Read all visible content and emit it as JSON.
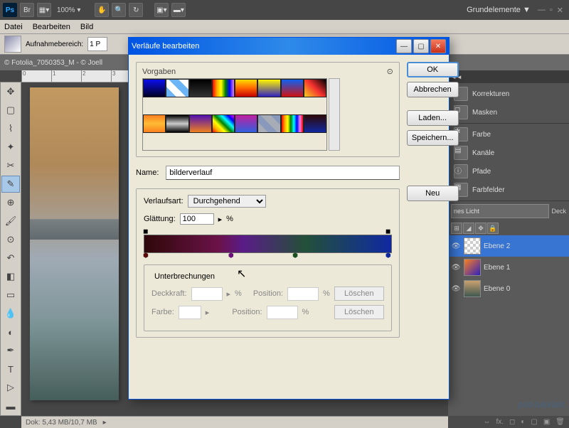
{
  "app": {
    "workspace": "Grundelemente"
  },
  "menu": [
    "Datei",
    "Bearbeiten",
    "Bild"
  ],
  "options": {
    "sample_label": "Aufnahmebereich:",
    "sample_value": "1 P"
  },
  "doc_tab": "© Fotolia_7050353_M - © Joell",
  "status": {
    "dock": "Dok: 5,43 MB/10,7 MB"
  },
  "panels": {
    "korrekturen": "Korrekturen",
    "masken": "Masken",
    "farbe": "Farbe",
    "kanale": "Kanäle",
    "pfade": "Pfade",
    "farbfelder": "Farbfelder"
  },
  "layers": {
    "blend": "nes Licht",
    "opacity_label": "Deck",
    "items": [
      {
        "name": "Ebene 2",
        "selected": true,
        "thumb": "checker"
      },
      {
        "name": "Ebene 1",
        "thumb": "gradient"
      },
      {
        "name": "Ebene 0",
        "thumb": "photo"
      }
    ]
  },
  "dialog": {
    "title": "Verläufe bearbeiten",
    "vorgaben_label": "Vorgaben",
    "buttons": {
      "ok": "OK",
      "cancel": "Abbrechen",
      "load": "Laden...",
      "save": "Speichern...",
      "new": "Neu"
    },
    "name_label": "Name:",
    "name_value": "bilderverlauf",
    "type_label": "Verlaufsart:",
    "type_value": "Durchgehend",
    "smooth_label": "Glättung:",
    "smooth_value": "100",
    "percent": "%",
    "unterb": {
      "title": "Unterbrechungen",
      "opacity": "Deckkraft:",
      "color": "Farbe:",
      "position": "Position:",
      "delete": "Löschen"
    }
  },
  "presets": [
    {
      "bg": "linear-gradient(#0a0eea,#020024)"
    },
    {
      "bg": "linear-gradient(45deg,#6bb4f5 25%,#fff 25%,#fff 50%,#6bb4f5 50%,#6bb4f5 75%,#fff 75%)"
    },
    {
      "bg": "linear-gradient(#000,#333)"
    },
    {
      "bg": "linear-gradient(90deg,red,orange,yellow,green,blue,violet)"
    },
    {
      "bg": "linear-gradient(#fd0,#ff6600,#c40000)"
    },
    {
      "bg": "linear-gradient(#fff500,#3020c0)"
    },
    {
      "bg": "linear-gradient(#1060f0,#d01010)"
    },
    {
      "bg": "linear-gradient(45deg,#f5d020,#f53030,#000)"
    },
    {
      "bg": "linear-gradient(#fa8020,#fb3,#fa8020)"
    },
    {
      "bg": "linear-gradient(#000,#ccc,#000)"
    },
    {
      "bg": "linear-gradient(#5010b0,#f08020)"
    },
    {
      "bg": "linear-gradient(45deg,red,orange,yellow,green,cyan,blue,magenta)"
    },
    {
      "bg": "linear-gradient(#c020a0,#3060e0)"
    },
    {
      "bg": "linear-gradient(45deg,rgba(180,180,180,.7) 25%,transparent 25%,transparent 50%,rgba(180,180,180,.7) 50%,rgba(180,180,180,.7) 75%,transparent 75%),#89b"
    },
    {
      "bg": "linear-gradient(90deg,red,orange,yellow,green,cyan,blue,violet,red)"
    },
    {
      "bg": "linear-gradient(#2e0808,#1028a0)"
    }
  ],
  "watermark": "psd-tutorials"
}
